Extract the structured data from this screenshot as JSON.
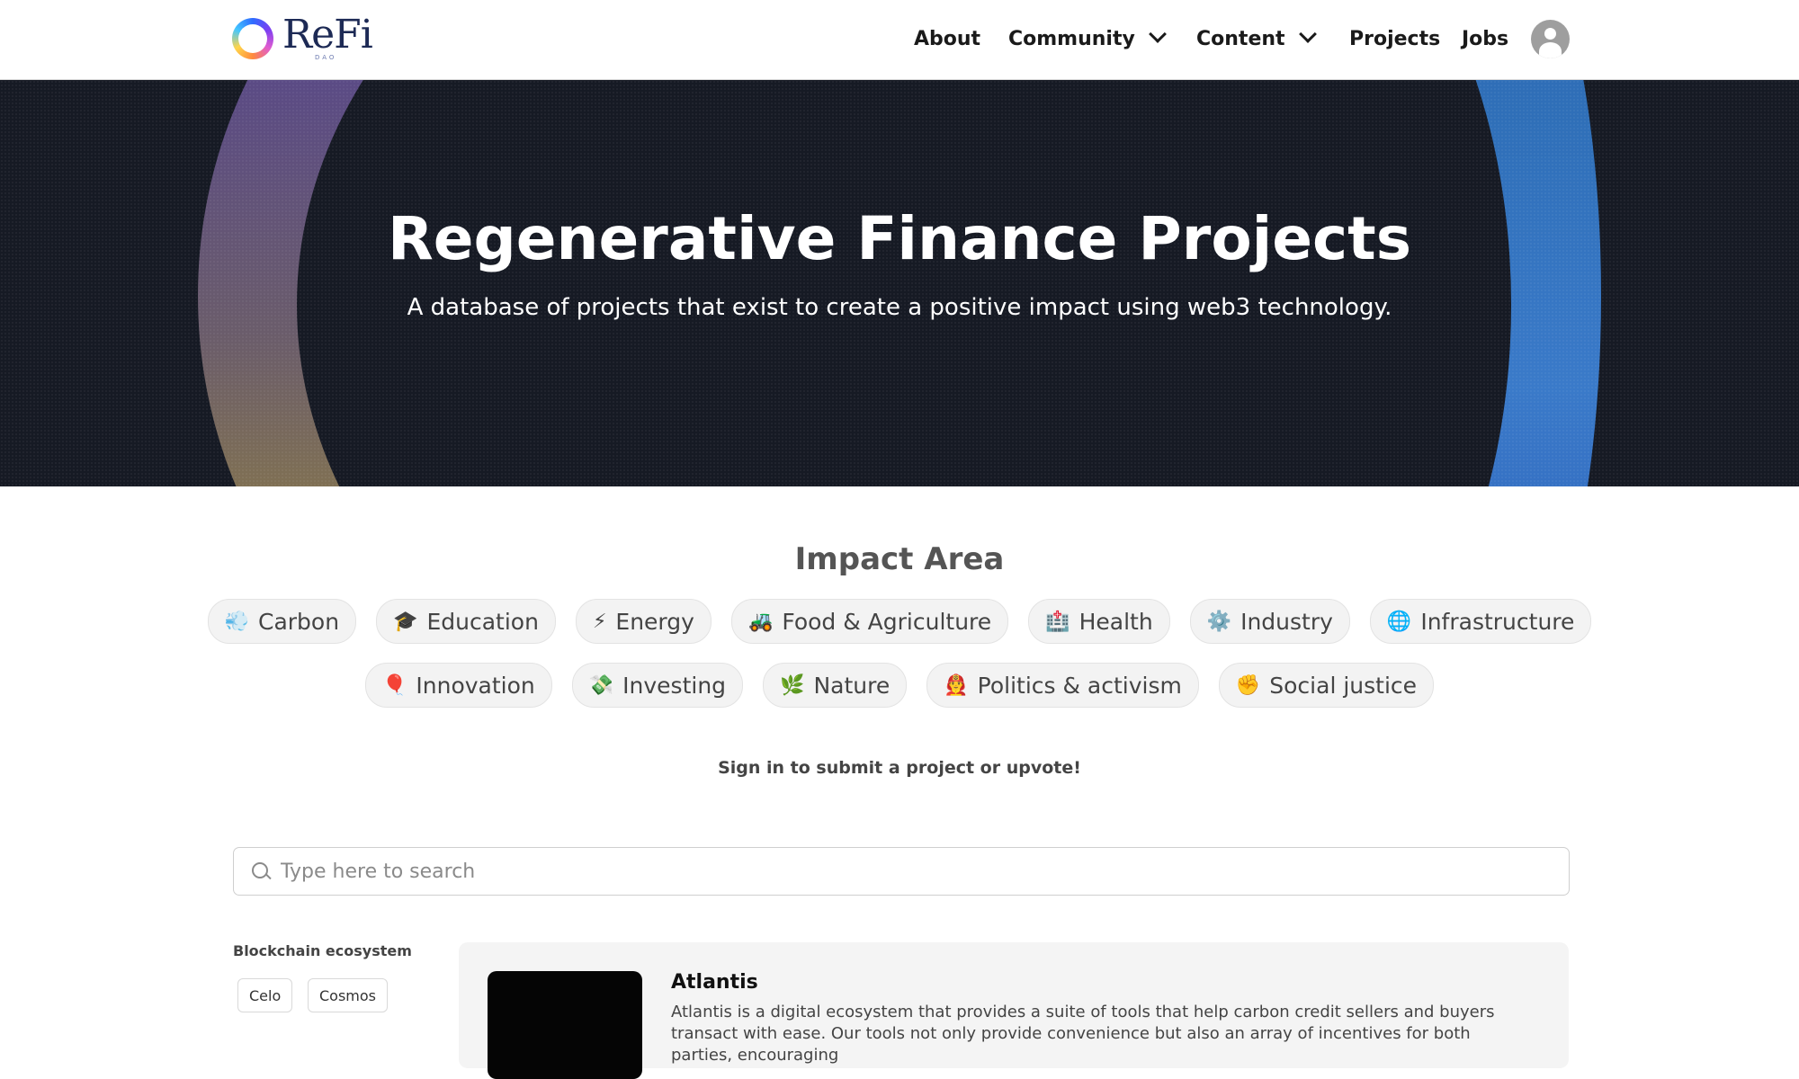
{
  "header": {
    "logo_text": "ReFi",
    "logo_sub": "DAO",
    "nav": [
      {
        "label": "About"
      },
      {
        "label": "Community"
      },
      {
        "label": "Content"
      },
      {
        "label": "Projects"
      },
      {
        "label": "Jobs"
      }
    ]
  },
  "hero": {
    "title": "Regenerative Finance Projects",
    "subtitle": "A database of projects that exist to create a positive impact using web3 technology."
  },
  "impact": {
    "title": "Impact Area",
    "areas": [
      {
        "icon": "💨",
        "label": "Carbon"
      },
      {
        "icon": "🎓",
        "label": "Education"
      },
      {
        "icon": "⚡",
        "label": "Energy"
      },
      {
        "icon": "🚜",
        "label": "Food & Agriculture"
      },
      {
        "icon": "🏥",
        "label": "Health"
      },
      {
        "icon": "⚙️",
        "label": "Industry"
      },
      {
        "icon": "🌐",
        "label": "Infrastructure"
      },
      {
        "icon": "🎈",
        "label": "Innovation"
      },
      {
        "icon": "💸",
        "label": "Investing"
      },
      {
        "icon": "🌿",
        "label": "Nature"
      },
      {
        "icon": "👨‍🚒",
        "label": "Politics & activism"
      },
      {
        "icon": "✊",
        "label": "Social justice"
      }
    ]
  },
  "signin_text": "Sign in to submit a project or upvote!",
  "search": {
    "placeholder": "Type here to search"
  },
  "filters": {
    "label": "Blockchain ecosystem",
    "options": [
      "Celo",
      "Cosmos"
    ]
  },
  "projects": [
    {
      "title": "Atlantis",
      "description": "Atlantis is a digital ecosystem that provides a suite of tools that help carbon credit sellers and buyers transact with ease. Our tools not only provide convenience but also an array of incentives for both parties, encouraging"
    }
  ]
}
